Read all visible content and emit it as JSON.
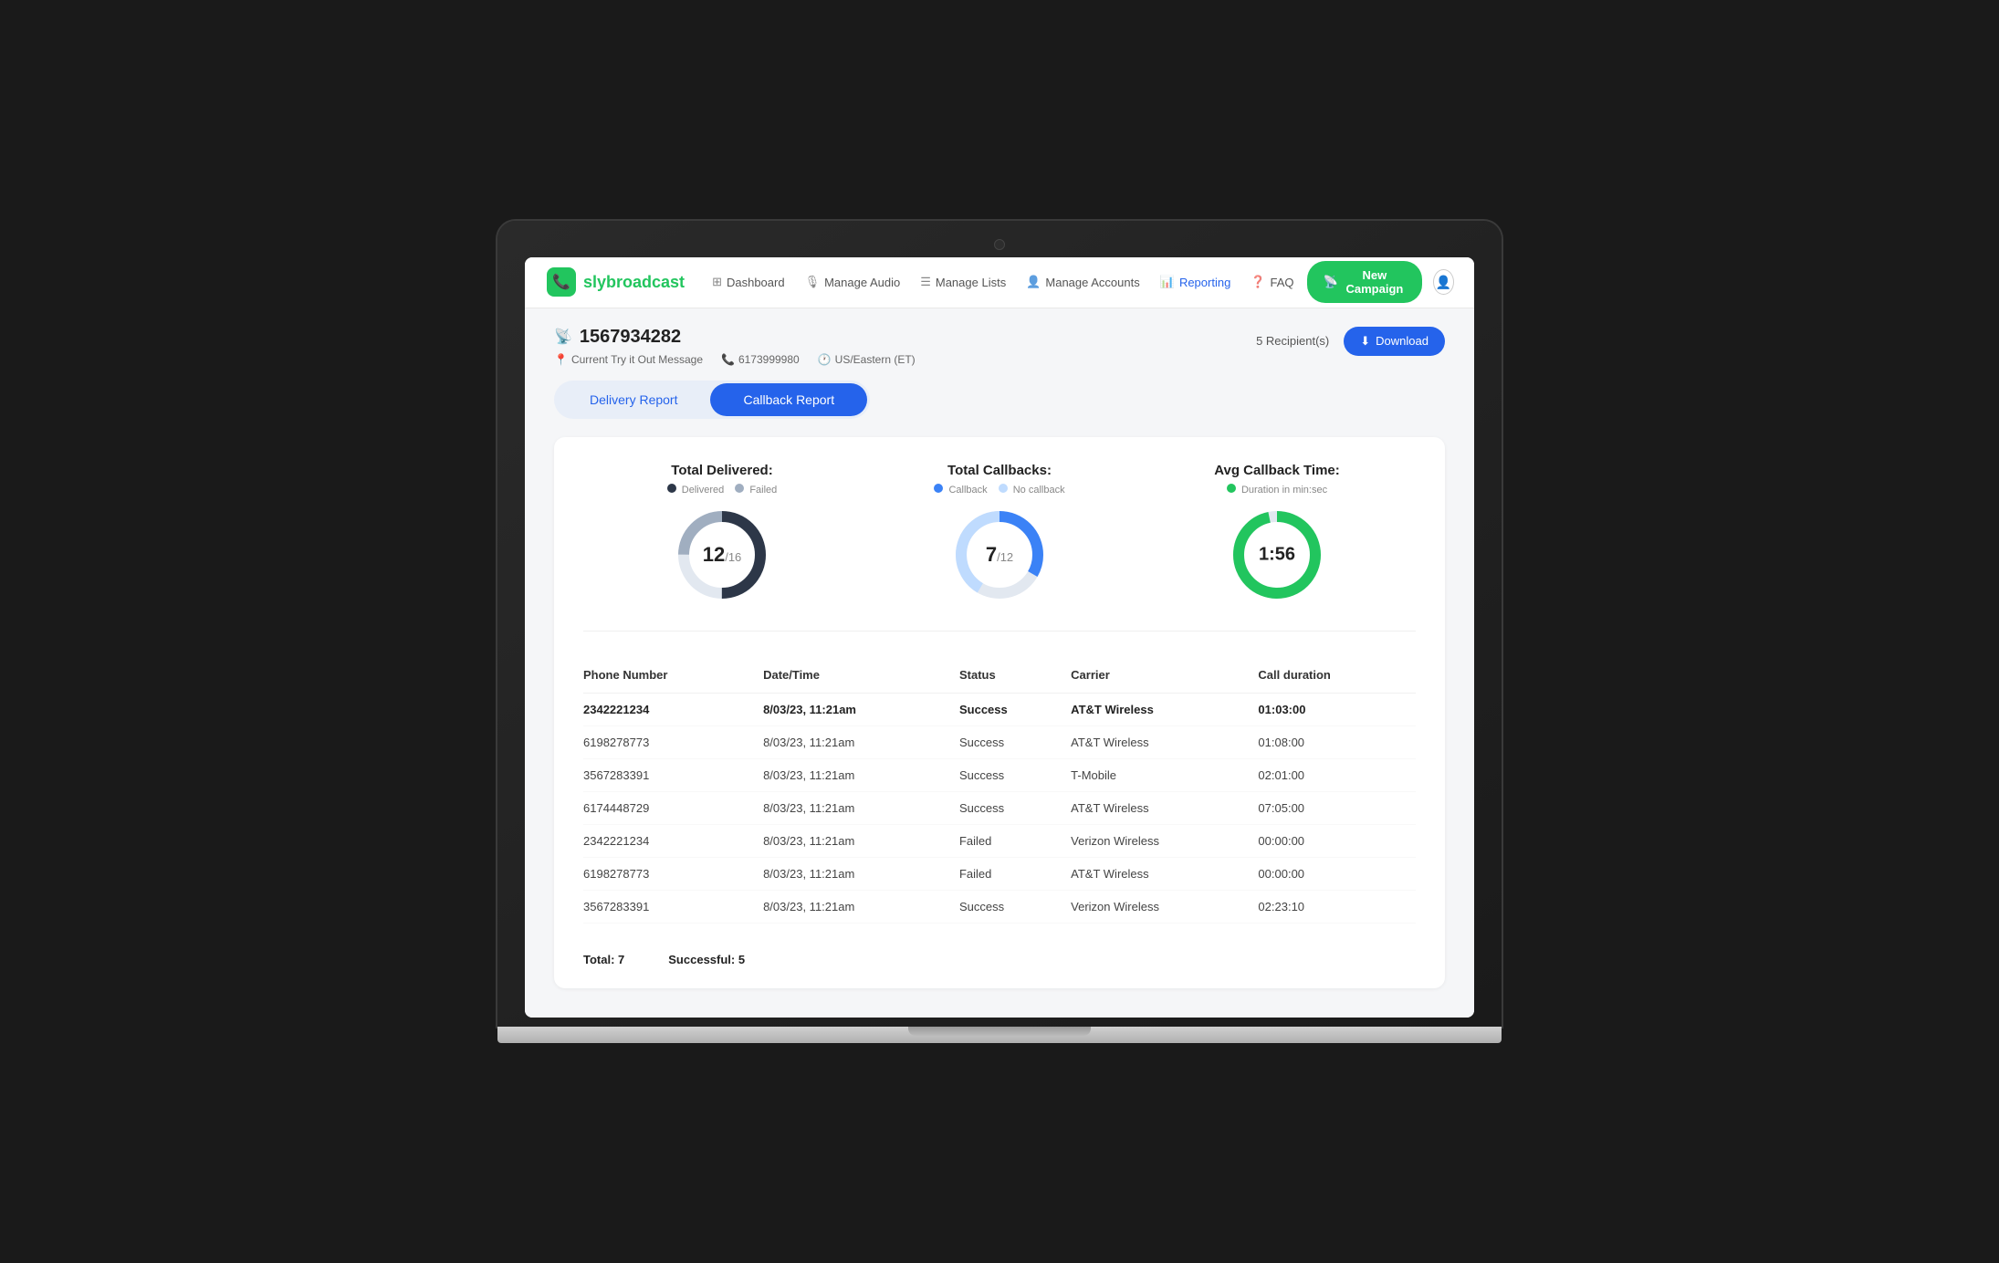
{
  "app": {
    "logo_text": "slybroadcast",
    "logo_icon": "📞"
  },
  "nav": {
    "items": [
      {
        "id": "dashboard",
        "label": "Dashboard",
        "icon": "⊞",
        "active": false
      },
      {
        "id": "manage-audio",
        "label": "Manage Audio",
        "icon": "🎙",
        "active": false
      },
      {
        "id": "manage-lists",
        "label": "Manage Lists",
        "icon": "☰",
        "active": false
      },
      {
        "id": "manage-accounts",
        "label": "Manage Accounts",
        "icon": "👤",
        "active": false
      },
      {
        "id": "reporting",
        "label": "Reporting",
        "icon": "📊",
        "active": true
      },
      {
        "id": "faq",
        "label": "FAQ",
        "icon": "❓",
        "active": false
      }
    ],
    "new_campaign_label": "New Campaign",
    "new_campaign_icon": "📡"
  },
  "page": {
    "campaign_id": "1567934282",
    "campaign_id_icon": "📡",
    "message_label": "Current Try it Out Message",
    "phone_number": "6173999980",
    "timezone": "US/Eastern (ET)",
    "recipients": "5 Recipient(s)",
    "download_label": "Download",
    "download_icon": "⬇"
  },
  "tabs": [
    {
      "id": "delivery",
      "label": "Delivery Report",
      "active": false
    },
    {
      "id": "callback",
      "label": "Callback Report",
      "active": true
    }
  ],
  "charts": {
    "delivered": {
      "title": "Total Delivered:",
      "value": "12",
      "total": "16",
      "legend_delivered": "Delivered",
      "legend_failed": "Failed",
      "delivered_count": 12,
      "failed_count": 4,
      "total_count": 16
    },
    "callbacks": {
      "title": "Total Callbacks:",
      "value": "7",
      "total": "12",
      "legend_callback": "Callback",
      "legend_no_callback": "No callback",
      "callback_count": 7,
      "no_callback_count": 5,
      "total_count": 12
    },
    "avg_time": {
      "title": "Avg Callback Time:",
      "value": "1:56",
      "legend_duration": "Duration in min:sec"
    }
  },
  "table": {
    "headers": [
      "Phone Number",
      "Date/Time",
      "Status",
      "Carrier",
      "Call duration"
    ],
    "rows": [
      {
        "phone": "2342221234",
        "datetime": "8/03/23, 11:21am",
        "status": "Success",
        "carrier": "AT&T Wireless",
        "duration": "01:03:00",
        "bold": true
      },
      {
        "phone": "6198278773",
        "datetime": "8/03/23, 11:21am",
        "status": "Success",
        "carrier": "AT&T Wireless",
        "duration": "01:08:00",
        "bold": false
      },
      {
        "phone": "3567283391",
        "datetime": "8/03/23, 11:21am",
        "status": "Success",
        "carrier": "T-Mobile",
        "duration": "02:01:00",
        "bold": false
      },
      {
        "phone": "6174448729",
        "datetime": "8/03/23, 11:21am",
        "status": "Success",
        "carrier": "AT&T Wireless",
        "duration": "07:05:00",
        "bold": false
      },
      {
        "phone": "2342221234",
        "datetime": "8/03/23, 11:21am",
        "status": "Failed",
        "carrier": "Verizon Wireless",
        "duration": "00:00:00",
        "bold": false
      },
      {
        "phone": "6198278773",
        "datetime": "8/03/23, 11:21am",
        "status": "Failed",
        "carrier": "AT&T Wireless",
        "duration": "00:00:00",
        "bold": false
      },
      {
        "phone": "3567283391",
        "datetime": "8/03/23, 11:21am",
        "status": "Success",
        "carrier": "Verizon Wireless",
        "duration": "02:23:10",
        "bold": false
      }
    ],
    "footer_total": "Total: 7",
    "footer_successful": "Successful: 5"
  },
  "colors": {
    "delivered_dark": "#2d3748",
    "delivered_light": "#a0aec0",
    "callback_blue": "#3b82f6",
    "no_callback_light": "#bfdbfe",
    "avg_green": "#22c55e",
    "brand_green": "#22c55e",
    "brand_blue": "#2563eb"
  }
}
